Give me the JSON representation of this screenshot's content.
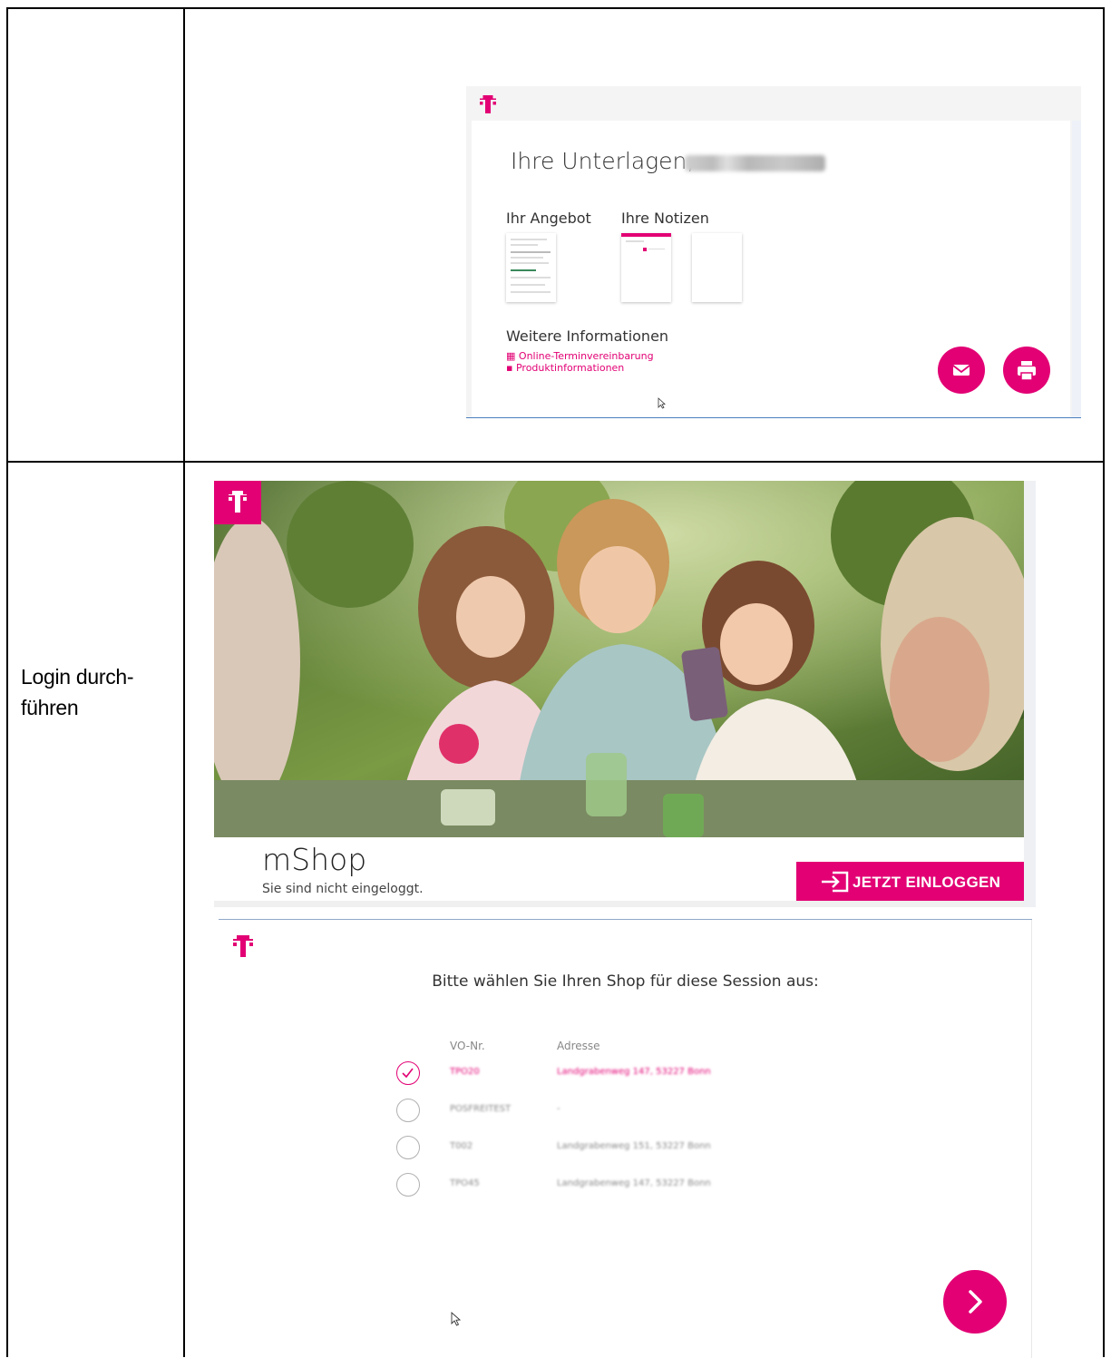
{
  "step": {
    "label_line1": "Login durch-",
    "label_line2": "führen"
  },
  "documents_screen": {
    "brand_icon": "telekom-t-logo",
    "greeting": "Ihre Unterlagen,",
    "offer_heading": "Ihr Angebot",
    "notes_heading": "Ihre Notizen",
    "more_info_heading": "Weitere Informationen",
    "links": [
      {
        "icon": "calendar-icon",
        "label": "Online-Terminvereinbarung"
      },
      {
        "icon": "product-icon",
        "label": "Produktinformationen"
      }
    ],
    "buttons": [
      {
        "icon": "mail-icon"
      },
      {
        "icon": "print-icon"
      }
    ]
  },
  "mshop_screen": {
    "brand_icon": "telekom-t-logo",
    "app_title": "mShop",
    "status_text": "Sie sind nicht eingeloggt.",
    "login_button": "JETZT EINLOGGEN"
  },
  "shop_select_screen": {
    "brand_icon": "telekom-t-logo",
    "question": "Bitte wählen Sie Ihren Shop für diese Session aus:",
    "columns": [
      "VO-Nr.",
      "Adresse"
    ],
    "rows": [
      {
        "selected": true,
        "vo": "TPO20",
        "address": "Landgrabenweg 147, 53227 Bonn"
      },
      {
        "selected": false,
        "vo": "POSFREITEST",
        "address": "-"
      },
      {
        "selected": false,
        "vo": "T002",
        "address": "Landgrabenweg 151, 53227 Bonn"
      },
      {
        "selected": false,
        "vo": "TPO45",
        "address": "Landgrabenweg 147, 53227 Bonn"
      }
    ],
    "next_button_icon": "chevron-right-icon"
  },
  "colors": {
    "brand_magenta": "#e20074"
  }
}
